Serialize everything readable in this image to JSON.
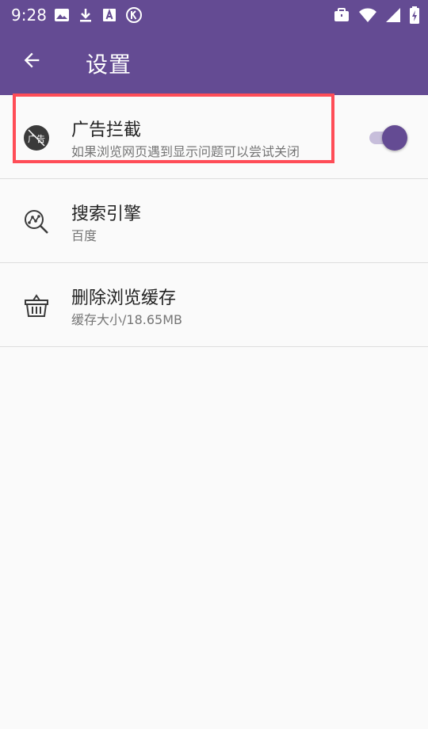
{
  "status_bar": {
    "time": "9:28",
    "left_icons": [
      "image-icon",
      "download-icon",
      "a-square-icon",
      "k-circle-icon"
    ],
    "right_icons": [
      "briefcase-icon",
      "wifi-icon",
      "signal-icon",
      "battery-charging-icon"
    ]
  },
  "app_bar": {
    "title": "设置",
    "back_icon": "arrow-left-icon",
    "color": "#644b93"
  },
  "settings": [
    {
      "title": "广告拦截",
      "subtitle": "如果浏览网页遇到显示问题可以尝试关闭",
      "icon": "ad-block-icon",
      "icon_text": "广告",
      "toggle_on": true
    },
    {
      "title": "搜索引擎",
      "subtitle": "百度",
      "icon": "search-engine-icon"
    },
    {
      "title": "删除浏览缓存",
      "subtitle": "缓存大小/18.65MB",
      "icon": "basket-icon"
    }
  ],
  "highlight_color": "#ff4d57"
}
